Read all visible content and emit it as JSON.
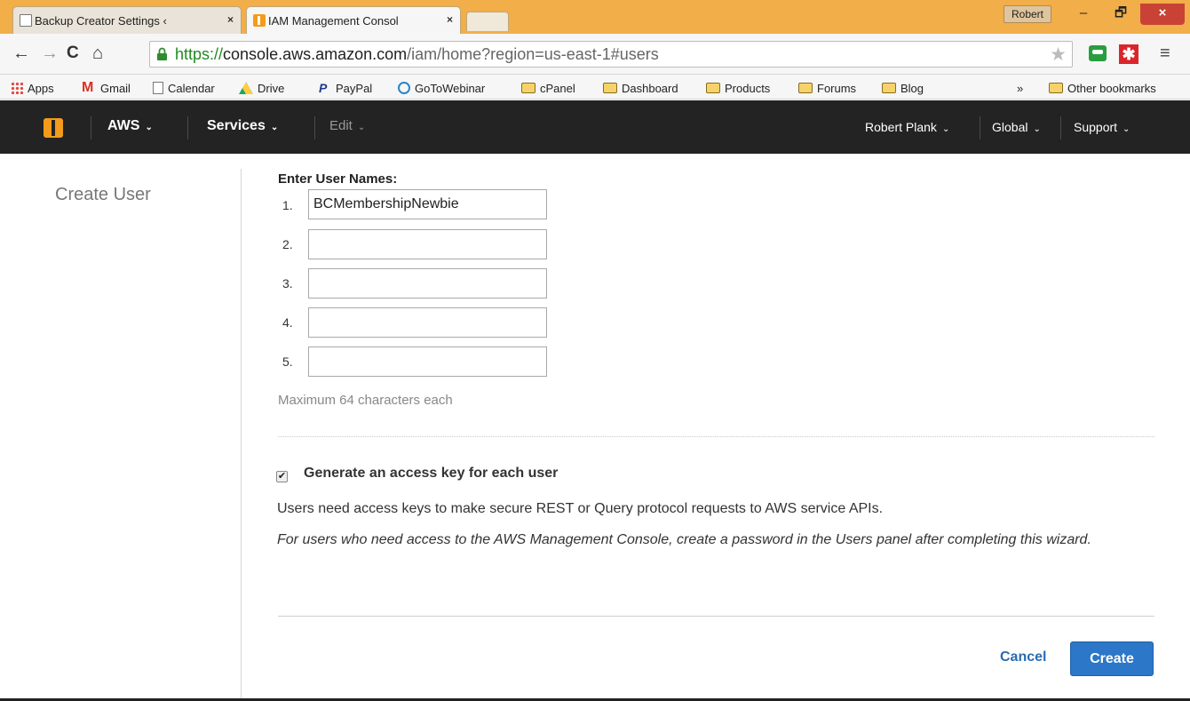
{
  "browser": {
    "tabs": [
      {
        "title": "Backup Creator Settings ‹",
        "close": "×",
        "favicon": "page-icon"
      },
      {
        "title": "IAM Management Consol",
        "close": "×",
        "favicon": "aws-box-icon"
      }
    ],
    "profile_name": "Robert",
    "window_controls": {
      "minimize": "–",
      "maximize": "🗗",
      "close": "×"
    },
    "url": {
      "scheme": "https://",
      "host": "console.aws.amazon.com",
      "path": "/iam/home?region=us-east-1#users"
    },
    "bookmarks": [
      {
        "label": "Apps",
        "icon": "apps-grid-icon"
      },
      {
        "label": "Gmail",
        "icon": "gmail-icon"
      },
      {
        "label": "Calendar",
        "icon": "page-icon"
      },
      {
        "label": "Drive",
        "icon": "drive-icon"
      },
      {
        "label": "PayPal",
        "icon": "paypal-icon"
      },
      {
        "label": "GoToWebinar",
        "icon": "gotowebinar-icon"
      },
      {
        "label": "cPanel",
        "icon": "folder-icon"
      },
      {
        "label": "Dashboard",
        "icon": "folder-icon"
      },
      {
        "label": "Products",
        "icon": "folder-icon"
      },
      {
        "label": "Forums",
        "icon": "folder-icon"
      },
      {
        "label": "Blog",
        "icon": "folder-icon"
      }
    ],
    "bookmarks_overflow": "»",
    "other_bookmarks": "Other bookmarks"
  },
  "aws_nav": {
    "aws": "AWS",
    "services": "Services",
    "edit": "Edit",
    "account": "Robert Plank",
    "region": "Global",
    "support": "Support",
    "caret": "⌄"
  },
  "page": {
    "left_title": "Create User",
    "enter_label": "Enter User Names:",
    "users": [
      {
        "num": "1.",
        "value": ""
      },
      {
        "num": "2.",
        "value": ""
      },
      {
        "num": "3.",
        "value": ""
      },
      {
        "num": "4.",
        "value": ""
      },
      {
        "num": "5.",
        "value": ""
      }
    ],
    "first_user_value": "BCMembershipNewbie",
    "max_hint": "Maximum 64 characters each",
    "access_key": {
      "checked": true,
      "check_glyph": "✔",
      "label": "Generate an access key for each user",
      "description": "Users need access keys to make secure REST or Query protocol requests to AWS service APIs.",
      "note": "For users who need access to the AWS Management Console, create a password in the Users panel after completing this wizard."
    },
    "cancel_label": "Cancel",
    "create_label": "Create"
  },
  "colors": {
    "tab_bar": "#f2ae48",
    "aws_nav_bg": "#232323",
    "aws_orange": "#f29b1c",
    "primary_button": "#2c77c8",
    "link_blue": "#2a6cb0"
  }
}
